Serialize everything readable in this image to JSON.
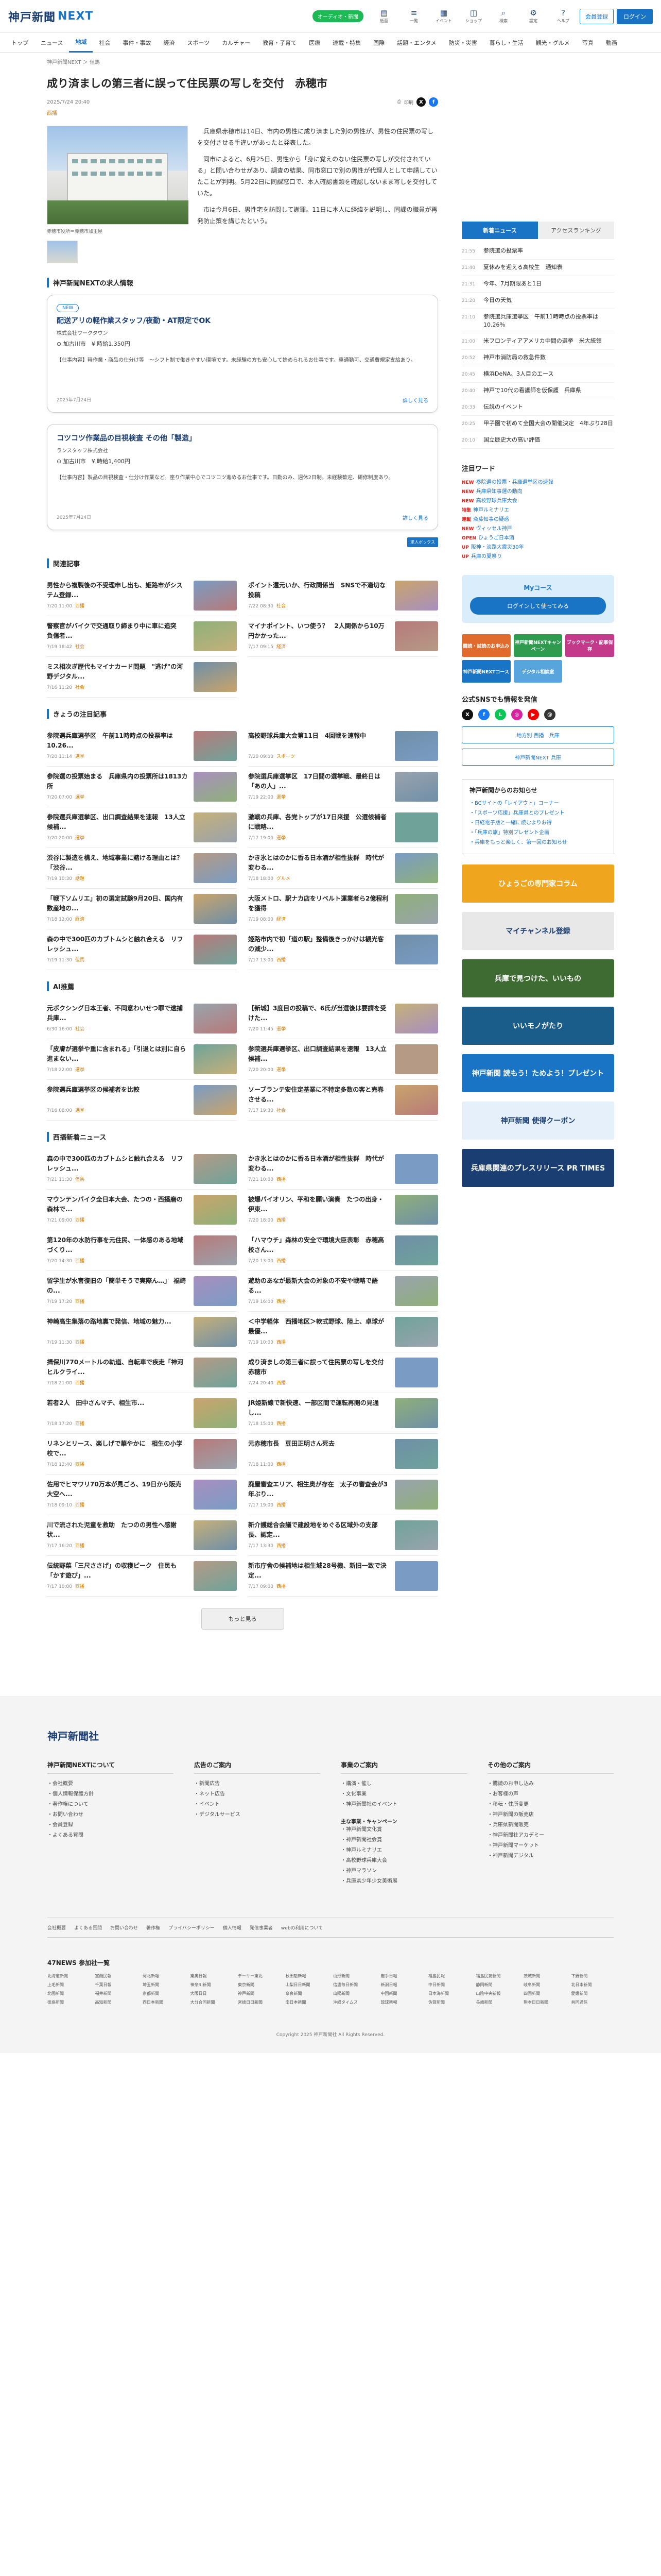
{
  "header": {
    "logo_main": "神戸新聞",
    "logo_sub": "NEXT",
    "badge": "オーディオ・新聞",
    "icons": [
      {
        "name": "paper-icon",
        "glyph": "▤",
        "label": "紙面"
      },
      {
        "name": "list-icon",
        "glyph": "≡",
        "label": "一覧"
      },
      {
        "name": "calendar-icon",
        "glyph": "▦",
        "label": "イベント"
      },
      {
        "name": "bag-icon",
        "glyph": "◫",
        "label": "ショップ"
      },
      {
        "name": "search-icon",
        "glyph": "⌕",
        "label": "検索"
      },
      {
        "name": "gear-icon",
        "glyph": "⚙",
        "label": "設定"
      },
      {
        "name": "help-icon",
        "glyph": "?",
        "label": "ヘルプ"
      }
    ],
    "register": "会員登録",
    "login": "ログイン"
  },
  "gnav": [
    "トップ",
    "ニュース",
    "地域",
    "社会",
    "事件・事故",
    "経済",
    "スポーツ",
    "カルチャー",
    "教育・子育て",
    "医療",
    "連載・特集",
    "国際",
    "話題・エンタメ",
    "防災・災害",
    "暮らし・生活",
    "観光・グルメ",
    "写真",
    "動画"
  ],
  "breadcrumb": "神戸新聞NEXT ＞ 但馬",
  "article": {
    "title": "成り済ましの第三者に誤って住民票の写しを交付　赤穂市",
    "date": "2025/7/24 20:40",
    "share_label": "印刷",
    "category": "西播",
    "caption": "赤穂市役所＝赤穂市加里屋",
    "paragraphs": [
      "兵庫県赤穂市は14日、市内の男性に成り済ました別の男性が、男性の住民票の写しを交付させる手違いがあったと発表した。",
      "同市によると、6月25日、男性から「身に覚えのない住民票の写しが交付されている」と問い合わせがあり、調査の結果、同市窓口で別の男性が代理人として申請していたことが判明。5月22日に同課窓口で、本人確認書類を確認しないまま写しを交付していた。",
      "市は今月6日、男性宅を訪問して謝罪。11日に本人に経緯を説明し、同課の職員が再発防止策を講じたという。"
    ]
  },
  "jobs": {
    "heading": "神戸新聞NEXTの求人情報",
    "sponsored": "求人ボックス",
    "items": [
      {
        "badge": "NEW",
        "title": "配送アリの軽作業スタッフ/夜勤・AT限定でOK",
        "company": "株式会社ワークタウン",
        "condition": "⊙ 加古川市　¥ 時給1,350円",
        "desc": "【仕事内容】軽作業・商品の仕分け等　～シフト制で働きやすい環境です。未経験の方も安心して始められるお仕事です。車通勤可、交通費規定支給あり。",
        "posted": "2025年7月24日",
        "more": "詳しく見る"
      },
      {
        "badge": "",
        "title": "コツコツ作業品の目視検査 その他「製造」",
        "company": "ランスタッフ株式会社",
        "condition": "⊙ 加古川市　¥ 時給1,400円",
        "desc": "【仕事内容】製品の目視検査・仕分け作業など。座り作業中心でコツコツ進めるお仕事です。日勤のみ、週休2日制。未経験歓迎、研修制度あり。",
        "posted": "2025年7月24日",
        "more": "詳しく見る"
      }
    ]
  },
  "sections": [
    {
      "heading": "関連記事",
      "items": [
        {
          "title": "男性から複製後の不受理申し出も、姫路市がシステム登録...",
          "meta": "7/20 11:00",
          "cat": "西播"
        },
        {
          "title": "ポイント還元いか、行政関係当　SNSで不適切な投稿",
          "meta": "7/22 08:30",
          "cat": "社会"
        },
        {
          "title": "警察官がバイクで交通取り締まり中に車に追突　負傷者...",
          "meta": "7/19 18:42",
          "cat": "社会"
        },
        {
          "title": "マイナポイント、いつ使う？　2人関係から10万円かかった...",
          "meta": "7/17 09:15",
          "cat": "経済"
        },
        {
          "title": "ミス相次ぎ歴代もマイナカード問題　\"逃げ\"の河野デジタル...",
          "meta": "7/16 11:20",
          "cat": "社会"
        }
      ]
    },
    {
      "heading": "きょうの注目記事",
      "items": [
        {
          "title": "参院選兵庫選挙区　午前11時時点の投票率は10.26...",
          "meta": "7/20 11:14",
          "cat": "選挙"
        },
        {
          "title": "高校野球兵庫大会第11日　4回戦を速報中",
          "meta": "7/20 09:00",
          "cat": "スポーツ"
        },
        {
          "title": "参院選の投票始まる　兵庫県内の投票所は1813カ所",
          "meta": "7/20 07:00",
          "cat": "選挙"
        },
        {
          "title": "参院選兵庫選挙区　17日間の選挙戦、最終日は「あの人」...",
          "meta": "7/19 22:00",
          "cat": "選挙"
        },
        {
          "title": "参院選兵庫選挙区、出口調査結果を速報　13人立候補...",
          "meta": "7/20 20:00",
          "cat": "選挙"
        },
        {
          "title": "激戦の兵庫、各党トップが17日来援　公選候補者に戦略...",
          "meta": "7/17 19:00",
          "cat": "選挙"
        },
        {
          "title": "渋谷に製造を構え、地域事業に賭ける理由とは？「渋谷...",
          "meta": "7/19 10:30",
          "cat": "話題"
        },
        {
          "title": "かき氷とはのかに香る日本酒が相性抜群　時代が変わる...",
          "meta": "7/18 18:00",
          "cat": "グルメ"
        },
        {
          "title": "「戦下ソムリエ」初の選定試験9月20日、国内有数産地の...",
          "meta": "7/18 12:00",
          "cat": "経済"
        },
        {
          "title": "大阪メトロ、駅ナカ店をリベルト運業者ら2億程利を獲得",
          "meta": "7/19 08:00",
          "cat": "経済"
        },
        {
          "title": "森の中で300匹のカブトムシと触れ合える　リフレッシュ...",
          "meta": "7/19 11:30",
          "cat": "但馬"
        },
        {
          "title": "姫路市内で初「道の駅」整備後きっかけは観光客の減少...",
          "meta": "7/17 13:00",
          "cat": "西播"
        }
      ]
    },
    {
      "heading": "AI推薦",
      "items": [
        {
          "title": "元ボクシング日本王者、不同意わいせつ罪で逮捕　兵庫...",
          "meta": "6/30 16:00",
          "cat": "社会"
        },
        {
          "title": "【新城】3度目の投稿で、6氏が当選後は要請を受けた...",
          "meta": "7/20 11:45",
          "cat": "選挙"
        },
        {
          "title": "「皮膚が選挙や重に含まれる」「引退とは別に自ら進まない...",
          "meta": "7/18 22:00",
          "cat": "選挙"
        },
        {
          "title": "参院選兵庫選挙区、出口調査結果を速報　13人立候補...",
          "meta": "7/20 20:00",
          "cat": "選挙"
        },
        {
          "title": "参院選兵庫選挙区の候補者を比較",
          "meta": "7/16 08:00",
          "cat": "選挙"
        },
        {
          "title": "ソーブランテ安住定基業に不特定多数の客と売春させる...",
          "meta": "7/17 19:30",
          "cat": "社会"
        }
      ]
    },
    {
      "heading": "西播新着ニュース",
      "items": [
        {
          "title": "森の中で300匹のカブトムシと触れ合える　リフレッシュ...",
          "meta": "7/21 11:30",
          "cat": "但馬"
        },
        {
          "title": "かき氷とはのかに香る日本酒が相性抜群　時代が変わる...",
          "meta": "7/21 10:00",
          "cat": "西播"
        },
        {
          "title": "マウンテンバイク全日本大会、たつの・西播磨の森林で...",
          "meta": "7/21 09:00",
          "cat": "西播"
        },
        {
          "title": "被爆バイオリン、平和を願い演奏　たつの出身・伊東...",
          "meta": "7/20 18:00",
          "cat": "西播"
        },
        {
          "title": "第120年の水防行事を元住民、一体感のある地域づくり...",
          "meta": "7/20 14:30",
          "cat": "西播"
        },
        {
          "title": "「ハマウチ」森林の安全で環境大臣表彰　赤穂高校さん...",
          "meta": "7/20 13:00",
          "cat": "西播"
        },
        {
          "title": "留学生が水害復旧の「簡単そうで実際ん…」　福崎の...",
          "meta": "7/19 17:20",
          "cat": "西播"
        },
        {
          "title": "遊助のあなが最新大会の対象の不安や戦略で語る...",
          "meta": "7/19 16:00",
          "cat": "西播"
        },
        {
          "title": "神崎高生集落の路地裏で発信、地域の魅力...",
          "meta": "7/19 11:30",
          "cat": "西播"
        },
        {
          "title": "＜中学軽体　西播地区＞軟式野球、陸上、卓球が最優...",
          "meta": "7/19 10:00",
          "cat": "西播"
        },
        {
          "title": "揖保川770メートルの軌道、自転車で疾走「神河ヒルクライ...",
          "meta": "7/18 21:00",
          "cat": "西播"
        },
        {
          "title": "成り済ましの第三者に誤って住民票の写しを交付　赤穂市",
          "meta": "7/24 20:40",
          "cat": "西播"
        },
        {
          "title": "若者2人　田中さんマチ、相生市...",
          "meta": "7/18 17:20",
          "cat": "西播"
        },
        {
          "title": "JR姫新線で新快速、一部区間で運転再開の見通し...",
          "meta": "7/18 15:00",
          "cat": "西播"
        },
        {
          "title": "リネンとリース、楽しげで華やかに　相生の小学校で...",
          "meta": "7/18 12:40",
          "cat": "西播"
        },
        {
          "title": "元赤穂市長　豆田正明さん死去",
          "meta": "7/18 11:00",
          "cat": "西播"
        },
        {
          "title": "佐用でヒマワリ70万本が見ごろ、19日から販売　大空へ...",
          "meta": "7/18 09:10",
          "cat": "西播"
        },
        {
          "title": "廃屋審査エリア、相生奥が存在　太子の審査会が3年ぶり...",
          "meta": "7/17 19:00",
          "cat": "西播"
        },
        {
          "title": "川で流された児童を救助　たつのの男性へ感謝状...",
          "meta": "7/17 16:20",
          "cat": "西播"
        },
        {
          "title": "新介護総合会議で建設地をめぐる区域外の支部長、認定...",
          "meta": "7/17 13:30",
          "cat": "西播"
        },
        {
          "title": "伝統野菜「三尺ささげ」の収穫ピーク　住民も「かす遊び」...",
          "meta": "7/17 10:00",
          "cat": "西播"
        },
        {
          "title": "新市庁舎の候補地は相生城28号機、新旧一致で決定...",
          "meta": "7/17 09:00",
          "cat": "西播"
        }
      ]
    }
  ],
  "more_button": "もっと見る",
  "sidebar": {
    "rank_tabs": [
      "新着ニュース",
      "アクセスランキング"
    ],
    "rank_items": [
      {
        "time": "21:55",
        "title": "参院選の投票率"
      },
      {
        "time": "21:40",
        "title": "夏休みを迎える高校生　通知表"
      },
      {
        "time": "21:31",
        "title": "今年、7月期限あと1日"
      },
      {
        "time": "21:20",
        "title": "今日の天気"
      },
      {
        "time": "21:10",
        "title": "参院選兵庫選挙区　午前11時時点の投票率は10.26％"
      },
      {
        "time": "21:00",
        "title": "米フロンティアアメリカ中間の選挙　米大統領"
      },
      {
        "time": "20:52",
        "title": "神戸市消防局の救急件数"
      },
      {
        "time": "20:45",
        "title": "横浜DeNA、3人目のエース"
      },
      {
        "time": "20:40",
        "title": "神戸で10代の看護師を仮保護　兵庫県"
      },
      {
        "time": "20:33",
        "title": "伝説のイベント"
      },
      {
        "time": "20:25",
        "title": "甲子園で初めて全国大会の開催決定　4年ぶり28日"
      },
      {
        "time": "20:10",
        "title": "国立歴史大の高い評価"
      }
    ],
    "kw_head": "注目ワード",
    "keywords": [
      {
        "tag": "NEW",
        "text": "参院選の投票・兵庫選挙区の速報"
      },
      {
        "tag": "NEW",
        "text": "兵庫県知事選の動向"
      },
      {
        "tag": "NEW",
        "text": "高校野球兵庫大会"
      },
      {
        "tag": "特集",
        "text": "神戸ルミナリエ"
      },
      {
        "tag": "連載",
        "text": "斎藤知事の疑惑"
      },
      {
        "tag": "NEW",
        "text": "ヴィッセル神戸"
      },
      {
        "tag": "OPEN",
        "text": "ひょうご日本酒"
      },
      {
        "tag": "UP",
        "text": "阪神・淡路大震災30年"
      },
      {
        "tag": "UP",
        "text": "兵庫の夏祭り"
      }
    ],
    "mycourse_title": "Myコース",
    "mycourse_btn": "ログインして使ってみる",
    "tiles": [
      {
        "label": "購読・試読のお申込み",
        "color": "#e06b2d"
      },
      {
        "label": "神戸新聞NEXTキャンペーン",
        "color": "#2e9b4e"
      },
      {
        "label": "ブックマーク・記事保存",
        "color": "#c43a8a"
      },
      {
        "label": "神戸新聞NEXTコース",
        "color": "#1a74c5"
      },
      {
        "label": "デジタル相談室",
        "color": "#58a4dc"
      },
      {
        "label": "",
        "color": "#ffffff"
      }
    ],
    "sns_head": "公式SNSでも情報を発信",
    "sns": [
      {
        "name": "x-icon",
        "glyph": "X",
        "color": "#111"
      },
      {
        "name": "facebook-icon",
        "glyph": "f",
        "color": "#1877f2"
      },
      {
        "name": "line-icon",
        "glyph": "L",
        "color": "#06c755"
      },
      {
        "name": "instagram-icon",
        "glyph": "◎",
        "color": "#d6249f"
      },
      {
        "name": "youtube-icon",
        "glyph": "▶",
        "color": "#e00"
      },
      {
        "name": "threads-icon",
        "glyph": "@",
        "color": "#333"
      }
    ],
    "side_btn1": "地方別 西播　兵庫",
    "side_btn2": "神戸新聞NEXT 兵庫",
    "from_head": "神戸新聞からのお知らせ",
    "from_links": [
      "・BCサイトの「レイアウト」コーナー",
      "・「スポーツ応援」兵庫県とのプレゼント",
      "・日経電子版と一緒に読むよりお得",
      "・「兵庫の旅」特別プレゼント企画",
      "・兵庫をもっと楽しく、第一回のお知らせ"
    ],
    "banners": [
      {
        "name": "banner-hyogo-college",
        "label": "ひょうごの専門家コラム",
        "color": "#f0a51e"
      },
      {
        "name": "banner-mychannel",
        "label": "マイチャンネル登録",
        "color": "#e8e8e8"
      },
      {
        "name": "banner-ad-1",
        "label": "兵庫で見つけた、いいもの",
        "color": "#3d6b32"
      },
      {
        "name": "banner-iimono",
        "label": "いいモノがたり",
        "color": "#1a5c8a"
      },
      {
        "name": "banner-kobe-news",
        "label": "神戸新聞 読もう！ためよう！プレゼント",
        "color": "#1a74c5"
      },
      {
        "name": "banner-coupon",
        "label": "神戸新聞 使得クーポン",
        "color": "#e6f0fa"
      },
      {
        "name": "banner-prtimes",
        "label": "兵庫県関連のプレスリリース PR TIMES",
        "color": "#1a3e72"
      }
    ]
  },
  "footer": {
    "logo": "神戸新聞社",
    "cols": [
      {
        "head": "神戸新聞NEXTについて",
        "links": [
          "・会社概要",
          "・個人情報保護方針",
          "・著作権について",
          "・お問い合わせ",
          "・会員登録",
          "・よくある質問"
        ],
        "sub": "",
        "sub_links": []
      },
      {
        "head": "広告のご案内",
        "links": [
          "・新聞広告",
          "・ネット広告",
          "・イベント",
          "・デジタルサービス"
        ],
        "sub": "",
        "sub_links": []
      },
      {
        "head": "事業のご案内",
        "links": [
          "・講演・催し",
          "・文化事業",
          "・神戸新聞社のイベント"
        ],
        "sub": "主な事業・キャンペーン",
        "sub_links": [
          "・神戸新聞文化賞",
          "・神戸新聞社会賞",
          "・神戸ルミナリエ",
          "・高校野球兵庫大会",
          "・神戸マラソン",
          "・兵庫県少年少女美術展"
        ]
      },
      {
        "head": "その他のご案内",
        "links": [
          "・購読のお申し込み",
          "・お客様の声",
          "・移転・住所変更",
          "・神戸新聞の販売店"
        ],
        "sub": "",
        "sub_links": [
          "・兵庫県新聞販売",
          "・神戸新聞社アカデミー",
          "・神戸新聞マーケット",
          "・神戸新聞デジタル"
        ]
      }
    ],
    "bar": [
      "会社概要",
      "よくある質問",
      "お問い合わせ",
      "著作権",
      "プライバシーポリシー",
      "個人情報",
      "発信事業者",
      "webの利用について"
    ],
    "net_head": "47NEWS 参加社一覧",
    "net": [
      "北海道新聞",
      "室蘭民報",
      "河北新報",
      "東奥日報",
      "デーリー東北",
      "秋田魁新報",
      "山形新聞",
      "岩手日報",
      "福島民報",
      "福島民友新聞",
      "茨城新聞",
      "下野新聞",
      "上毛新聞",
      "千葉日報",
      "埼玉新聞",
      "神奈川新聞",
      "東京新聞",
      "山梨日日新聞",
      "信濃毎日新聞",
      "新潟日報",
      "中日新聞",
      "静岡新聞",
      "岐阜新聞",
      "北日本新聞",
      "北國新聞",
      "福井新聞",
      "京都新聞",
      "大阪日日",
      "神戸新聞",
      "奈良新聞",
      "山陽新聞",
      "中国新聞",
      "日本海新聞",
      "山陰中央新報",
      "四国新聞",
      "愛媛新聞",
      "徳島新聞",
      "高知新聞",
      "西日本新聞",
      "大分合同新聞",
      "宮崎日日新聞",
      "南日本新聞",
      "沖縄タイムス",
      "琉球新報",
      "佐賀新聞",
      "長崎新聞",
      "熊本日日新聞",
      "共同通信"
    ],
    "copyright": "Copyright 2025 神戸新聞社 All Rights Reserved."
  }
}
